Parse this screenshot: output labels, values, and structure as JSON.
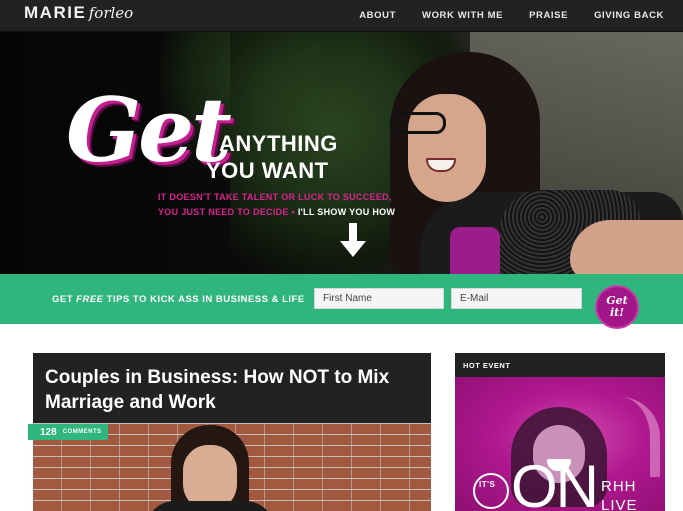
{
  "header": {
    "logo_primary": "MARIE",
    "logo_secondary": "forleo",
    "nav": [
      {
        "label": "ABOUT"
      },
      {
        "label": "WORK WITH ME"
      },
      {
        "label": "PRAISE"
      },
      {
        "label": "GIVING BACK"
      }
    ]
  },
  "hero": {
    "script_word": "Get",
    "line1": "ANYTHING",
    "line2": "YOU WANT",
    "sub1": "IT DOESN'T TAKE TALENT OR LUCK TO SUCCEED,",
    "sub2_pink": "YOU JUST NEED TO DECIDE • ",
    "sub2_white": "I'LL SHOW YOU HOW",
    "arrow_icon": "arrow-down-icon"
  },
  "signup": {
    "text_before": "GET ",
    "text_emph": "FREE",
    "text_after": " TIPS TO KICK ASS IN BUSINESS & LIFE",
    "first_name_placeholder": "First Name",
    "email_placeholder": "E-Mail",
    "button_line1": "Get",
    "button_line2": "it!"
  },
  "article": {
    "title": "Couples in Business: How NOT to Mix Marriage and Work",
    "comments_count": "128",
    "comments_label": "COMMENTS"
  },
  "event": {
    "label": "HOT EVENT",
    "its": "IT'S",
    "on": "ON",
    "rhh": "RHH",
    "live": "LIVE"
  },
  "colors": {
    "nav_bg": "#222222",
    "accent_green": "#2fb67d",
    "accent_magenta": "#b0188f",
    "hero_pink": "#d9248f"
  }
}
